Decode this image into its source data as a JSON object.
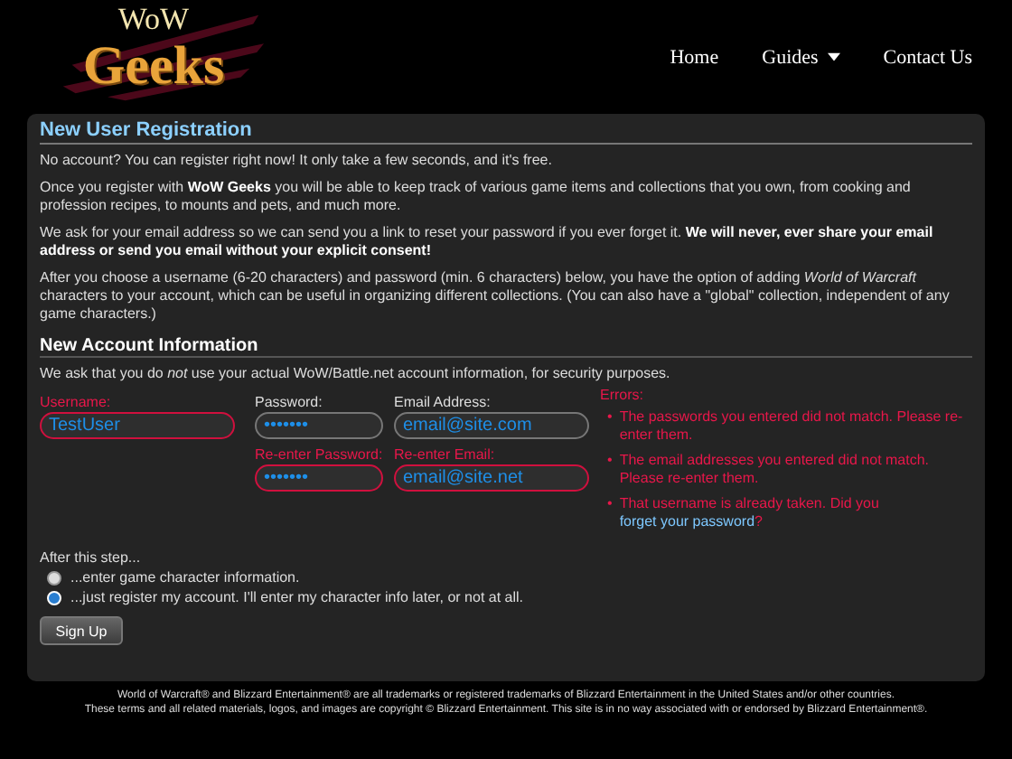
{
  "logo": {
    "top": "WoW",
    "bottom": "Geeks"
  },
  "nav": [
    {
      "label": "Home",
      "dropdown": false
    },
    {
      "label": "Guides",
      "dropdown": true
    },
    {
      "label": "Contact Us",
      "dropdown": false
    }
  ],
  "registration": {
    "title": "New User Registration",
    "paragraphs": [
      "No account? You can register right now! It only take a few seconds, and it's free.",
      "Once you register with **WoW Geeks** you will be able to keep track of various game items and collections that you own, from cooking and profession recipes, to mounts and pets, and much more.",
      "We ask for your email address so we can send you a link to reset your password if you ever forget it. **We will never, ever share your email address or send you email without your explicit consent!**",
      "After you choose a username (6-20 characters) and password (min. 6 characters) below, you have the option of adding *World of Warcraft* characters to your account, which can be useful in organizing different collections. (You can also have a \"global\" collection, independent of any game characters.)"
    ]
  },
  "account": {
    "title": "New Account Information",
    "note": "We ask that you do *not* use your actual WoW/Battle.net account information, for security purposes.",
    "field_columns": [
      [
        {
          "label": "Username:",
          "value": "TestUser",
          "invalid": true
        }
      ],
      [
        {
          "label": "Password:",
          "value": "•••••••",
          "invalid": false
        },
        {
          "label": "Re-enter Password:",
          "value": "•••••••",
          "invalid": true
        }
      ],
      [
        {
          "label": "Email Address:",
          "value": "email@site.com",
          "invalid": false
        },
        {
          "label": "Re-enter Email:",
          "value": "email@site.net",
          "invalid": true
        }
      ]
    ],
    "errors_title": "Errors:",
    "errors": [
      {
        "marker": "•",
        "text": "The passwords you entered did not match. Please re-enter them."
      },
      {
        "marker": "•",
        "text": "The email addresses you entered did not match. Please re-enter them."
      },
      {
        "marker": "•",
        "text": "That username is already taken. Did you ",
        "link": "forget your password",
        "after": "?"
      }
    ],
    "after_step": "After this step...",
    "options": [
      {
        "label": "...enter game character information.",
        "selected": false
      },
      {
        "label": "...just register my account. I'll enter my character info later, or not at all.",
        "selected": true
      }
    ],
    "submit": "Sign Up"
  },
  "footer": [
    "World of Warcraft® and Blizzard Entertainment® are all trademarks or registered trademarks of Blizzard Entertainment in the United States and/or other countries.",
    "These terms and all related materials, logos, and images are copyright © Blizzard Entertainment. This site is in no way associated with or endorsed by Blizzard Entertainment®."
  ]
}
